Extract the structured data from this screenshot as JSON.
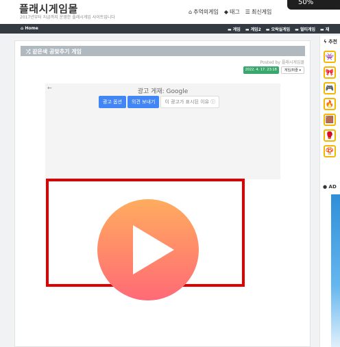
{
  "header": {
    "title": "플래시게임몰",
    "subtitle": "2017년부터 지금까지 운영한 플래시게임 사이트입니다",
    "nav": [
      {
        "icon": "home-icon",
        "label": "추억의게임"
      },
      {
        "icon": "tag-icon",
        "label": "태그"
      },
      {
        "icon": "list-icon",
        "label": "최신게임"
      }
    ]
  },
  "overlay": {
    "text": "50%"
  },
  "menubar": {
    "home": "Home",
    "items": [
      "게임",
      "게임2",
      "오락실게임",
      "멀티게임",
      "재"
    ]
  },
  "post": {
    "title": "같은색 공맞추기 게임",
    "posted_by": "Posted by 플래시게임몰",
    "date": "2022. 4. 17. 23:18",
    "category": "게임/퍼즐"
  },
  "ad": {
    "label": "광고 게재: Google",
    "options_button": "광고 옵션",
    "feedback_button": "의견 보내기",
    "why_button": "이 광고가 표시된 이유 ⓘ"
  },
  "sidebar": {
    "heading": "추천",
    "ad_heading": "AD"
  },
  "colors": {
    "menubar": "#333a42",
    "badge": "#3aa76d",
    "play_top": "#ffac5e",
    "play_bottom": "#ff6a76",
    "frame": "#e00000",
    "icon_border": "#f2b800"
  }
}
